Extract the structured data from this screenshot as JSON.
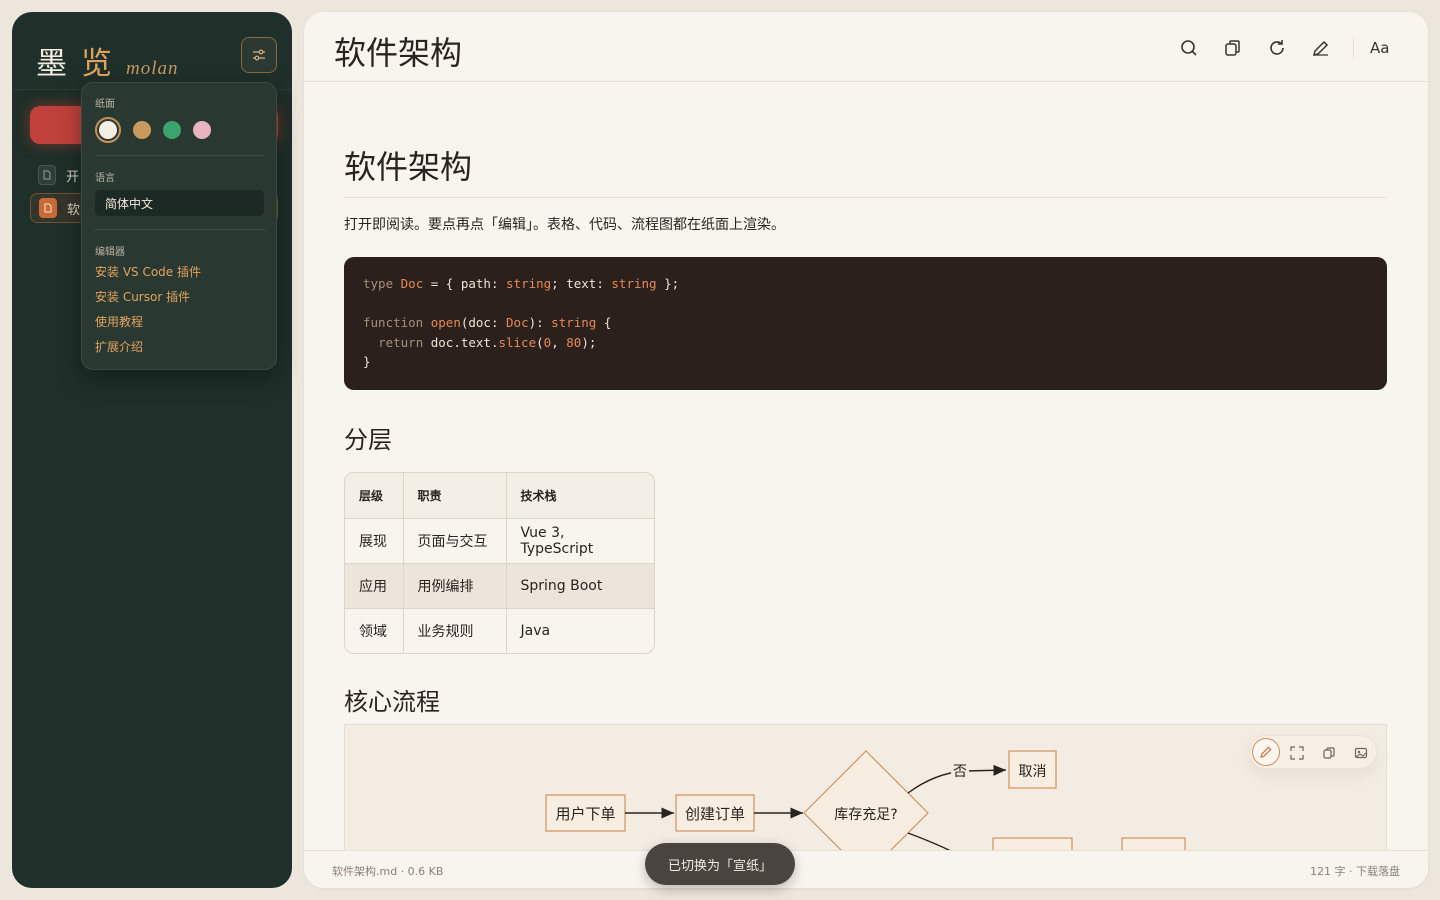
{
  "brand": {
    "char1": "墨",
    "char2": "览",
    "latin": "molan"
  },
  "sidebar": {
    "files": [
      {
        "name": "开",
        "active": false
      },
      {
        "name": "软",
        "active": true
      }
    ]
  },
  "settings_popup": {
    "paper_label": "纸面",
    "paper_colors": [
      "#f4efe4",
      "#c89a5e",
      "#3ba36b",
      "#e8b4c0"
    ],
    "language_label": "语言",
    "language_value": "简体中文",
    "editor_label": "编辑器",
    "links": [
      "安装 VS Code 插件",
      "安装 Cursor 插件",
      "使用教程",
      "扩展介绍"
    ]
  },
  "header": {
    "title": "软件架构",
    "tools": [
      "search-icon",
      "copy-icon",
      "refresh-icon",
      "edit-icon",
      "font-size-icon"
    ],
    "font_toggle": "Aa"
  },
  "document": {
    "h1": "软件架构",
    "intro": "打开即阅读。要点再点「编辑」。表格、代码、流程图都在纸面上渲染。",
    "code": {
      "line1": {
        "kw": "type",
        "name": "Doc",
        "rest1": " = { path: ",
        "t1": "string",
        "rest2": "; text: ",
        "t2": "string",
        "rest3": " };"
      },
      "line3": {
        "kw": "function",
        "fn": "open",
        "rest1": "(doc: ",
        "ty": "Doc",
        "rest2": "): ",
        "ret": "string",
        "rest3": " {"
      },
      "line4": {
        "kw": "return",
        "rest1": " doc.text.",
        "fn": "slice",
        "rest2": "(",
        "n1": "0",
        "rest3": ", ",
        "n2": "80",
        "rest4": ");"
      },
      "line5": "}"
    },
    "h2_layers": "分层",
    "table": {
      "headers": [
        "层级",
        "职责",
        "技术栈"
      ],
      "rows": [
        [
          "展现",
          "页面与交互",
          "Vue 3, TypeScript"
        ],
        [
          "应用",
          "用例编排",
          "Spring Boot"
        ],
        [
          "领域",
          "业务规则",
          "Java"
        ]
      ]
    },
    "h2_flow": "核心流程",
    "flow": {
      "nodes": [
        "用户下单",
        "创建订单",
        "库存充足?",
        "取消"
      ],
      "edge_labels": [
        "否"
      ],
      "tools": [
        "edit-icon",
        "fullscreen-icon",
        "copy-icon",
        "image-icon"
      ]
    }
  },
  "footer": {
    "left": "软件架构.md · 0.6 KB",
    "right": "121 字 · 下载落盘"
  },
  "toast": "已切换为「宣纸」",
  "colors": {
    "accent": "#e0a35d",
    "sidebar_bg": "#1f2f29",
    "paper": "#f8f5ef",
    "primary_button": "#c0413b"
  }
}
